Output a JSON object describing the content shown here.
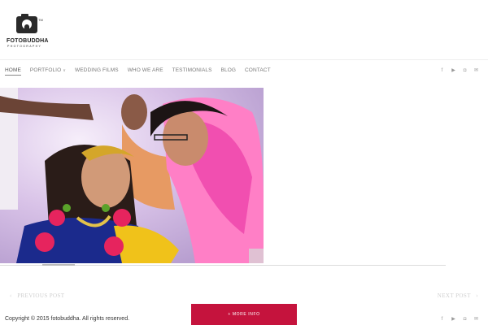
{
  "logo": {
    "brand": "FOTOBUDDHA",
    "tagline": "PHOTOGRAPHY",
    "tm": "TM"
  },
  "nav": {
    "items": [
      {
        "label": "HOME"
      },
      {
        "label": "PORTFOLIO"
      },
      {
        "label": "WEDDING FILMS"
      },
      {
        "label": "WHO WE ARE"
      },
      {
        "label": "TESTIMONIALS"
      },
      {
        "label": "BLOG"
      },
      {
        "label": "CONTACT"
      }
    ],
    "caret": "∨"
  },
  "social_icons": [
    "facebook-icon",
    "youtube-icon",
    "instagram-icon",
    "email-icon"
  ],
  "social_glyphs": {
    "facebook": "f",
    "youtube": "▶",
    "instagram": "◘",
    "email": "✉"
  },
  "pager": {
    "prev": "PREVIOUS POST",
    "next": "NEXT POST",
    "prev_arrow": "‹",
    "next_arrow": "›"
  },
  "footer": {
    "copyright": "Copyright © 2015 fotobuddha. All rights reserved.",
    "more_button": "MORE INFO",
    "more_glyph": "+"
  },
  "colors": {
    "accent": "#c5133d"
  }
}
